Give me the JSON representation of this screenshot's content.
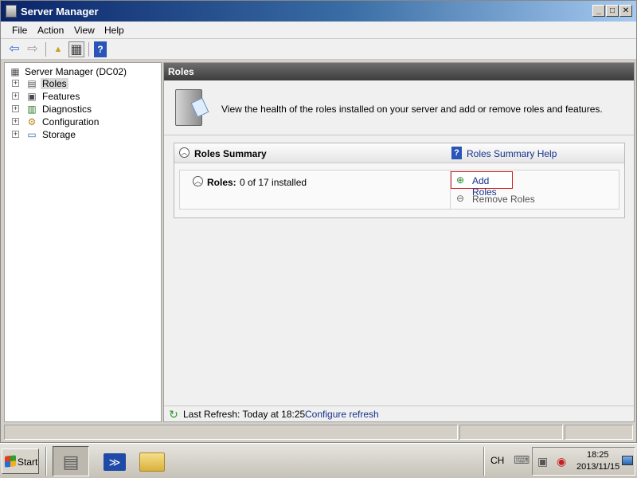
{
  "window": {
    "title": "Server Manager"
  },
  "title_buttons": {
    "minimize": "_",
    "maximize": "□",
    "close": "✕"
  },
  "menu": [
    "File",
    "Action",
    "View",
    "Help"
  ],
  "toolbar": {
    "back_glyph": "⇦",
    "forward_glyph": "⇨",
    "up_glyph": "▲",
    "showhide_glyph": "▦",
    "help_glyph": "?"
  },
  "tree": {
    "root": "Server Manager (DC02)",
    "items": [
      {
        "label": "Roles",
        "icon": "roles-icon",
        "selected": true
      },
      {
        "label": "Features",
        "icon": "features-icon"
      },
      {
        "label": "Diagnostics",
        "icon": "diagnostics-icon"
      },
      {
        "label": "Configuration",
        "icon": "configuration-icon"
      },
      {
        "label": "Storage",
        "icon": "storage-icon"
      }
    ],
    "expander_glyph": "+"
  },
  "content": {
    "header": "Roles",
    "intro": "View the health of the roles installed on your server and add or remove roles and features.",
    "summary": {
      "title": "Roles Summary",
      "help_link": "Roles Summary Help",
      "roles_label": "Roles:",
      "roles_count": "0 of 17 installed",
      "add_roles": "Add Roles",
      "remove_roles": "Remove Roles"
    },
    "chevron_glyph": "︿",
    "refresh": {
      "label": "Last Refresh: Today at 18:25",
      "link": "Configure refresh"
    }
  },
  "taskbar": {
    "start": "Start",
    "lang": "CH",
    "time": "18:25",
    "date": "2013/11/15"
  },
  "colors": {
    "link": "#15328c",
    "highlight_border": "#d02020",
    "header_bg": "#4a4a4a"
  }
}
